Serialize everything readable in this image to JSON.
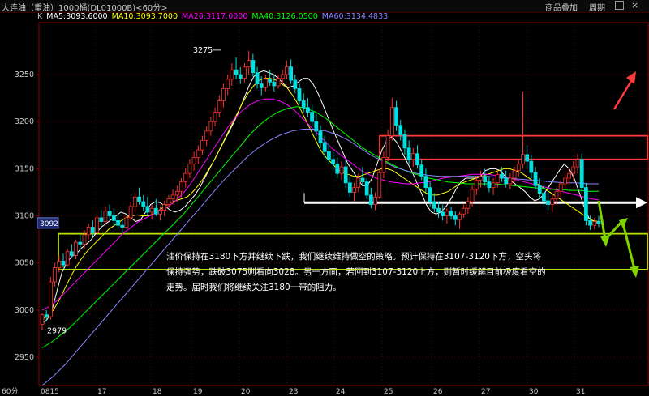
{
  "header": {
    "instrument": "大连油（重油）1000桶(DL01000B)<60分>",
    "menu_add": "商品叠加",
    "menu_period": "周期",
    "k_label": "K"
  },
  "indicators": [
    {
      "label": "MA5:3093.6000",
      "color": "#ffffff"
    },
    {
      "label": "MA10:3093.7000",
      "color": "#ffff00"
    },
    {
      "label": "MA20:3117.0000",
      "color": "#ff00ff"
    },
    {
      "label": "MA40:3126.0500",
      "color": "#00ff00"
    },
    {
      "label": "MA60:3134.4833",
      "color": "#8888ff"
    }
  ],
  "period_label": "60分",
  "current_price_tag": "3092",
  "annotation": {
    "text": "油价保持在3180下方并继续下跌，我们继续维持做空的策略。预计保持在3107-3120下方，空头将保持强势，跌破3075则看向3028。另一方面，若回到3107-3120上方，则暂时缓解目前极度看空的走势。届时我们将继续关注3180一带的阻力。"
  },
  "chart_data": {
    "type": "candlestick",
    "title": "",
    "xlabel": "",
    "ylabel": "",
    "ylim": [
      2920,
      3305
    ],
    "y_ticks": [
      2950,
      3000,
      3050,
      3100,
      3150,
      3200,
      3250
    ],
    "x_tick_labels": [
      "0815",
      "17",
      "18",
      "19",
      "20",
      "23",
      "24",
      "25",
      "26",
      "27",
      "30",
      "31"
    ],
    "high_label": "3275",
    "low_label": "2979",
    "zones": [
      {
        "name": "resistance",
        "low": 3160,
        "high": 3185,
        "color": "#ff3b3b"
      },
      {
        "name": "support",
        "low": 3043,
        "high": 3081,
        "color": "#b8e000"
      }
    ],
    "level_line": 3114,
    "candles": [
      [
        2985,
        2997,
        2979,
        2995
      ],
      [
        2995,
        3000,
        2988,
        2993
      ],
      [
        2993,
        3035,
        2990,
        3030
      ],
      [
        3030,
        3050,
        3025,
        3045
      ],
      [
        3045,
        3058,
        3040,
        3052
      ],
      [
        3052,
        3060,
        3045,
        3048
      ],
      [
        3048,
        3065,
        3046,
        3062
      ],
      [
        3062,
        3070,
        3055,
        3058
      ],
      [
        3058,
        3075,
        3054,
        3072
      ],
      [
        3072,
        3080,
        3066,
        3070
      ],
      [
        3070,
        3085,
        3065,
        3080
      ],
      [
        3080,
        3092,
        3075,
        3088
      ],
      [
        3088,
        3095,
        3078,
        3082
      ],
      [
        3082,
        3100,
        3080,
        3098
      ],
      [
        3098,
        3106,
        3090,
        3094
      ],
      [
        3094,
        3110,
        3090,
        3105
      ],
      [
        3105,
        3112,
        3096,
        3100
      ],
      [
        3100,
        3108,
        3090,
        3095
      ],
      [
        3095,
        3100,
        3085,
        3090
      ],
      [
        3090,
        3096,
        3082,
        3088
      ],
      [
        3088,
        3100,
        3086,
        3098
      ],
      [
        3098,
        3115,
        3095,
        3110
      ],
      [
        3110,
        3125,
        3104,
        3120
      ],
      [
        3120,
        3130,
        3112,
        3115
      ],
      [
        3115,
        3122,
        3105,
        3110
      ],
      [
        3110,
        3120,
        3100,
        3104
      ],
      [
        3104,
        3112,
        3096,
        3108
      ],
      [
        3108,
        3118,
        3100,
        3102
      ],
      [
        3102,
        3110,
        3095,
        3106
      ],
      [
        3106,
        3116,
        3100,
        3112
      ],
      [
        3112,
        3122,
        3108,
        3118
      ],
      [
        3118,
        3128,
        3112,
        3122
      ],
      [
        3122,
        3132,
        3115,
        3126
      ],
      [
        3126,
        3140,
        3120,
        3136
      ],
      [
        3136,
        3150,
        3130,
        3145
      ],
      [
        3145,
        3160,
        3140,
        3155
      ],
      [
        3155,
        3168,
        3148,
        3162
      ],
      [
        3162,
        3175,
        3155,
        3170
      ],
      [
        3170,
        3185,
        3165,
        3180
      ],
      [
        3180,
        3195,
        3174,
        3190
      ],
      [
        3190,
        3205,
        3185,
        3200
      ],
      [
        3200,
        3215,
        3195,
        3210
      ],
      [
        3210,
        3228,
        3205,
        3222
      ],
      [
        3222,
        3240,
        3215,
        3235
      ],
      [
        3235,
        3250,
        3228,
        3245
      ],
      [
        3245,
        3262,
        3238,
        3255
      ],
      [
        3255,
        3268,
        3245,
        3250
      ],
      [
        3250,
        3258,
        3240,
        3246
      ],
      [
        3246,
        3262,
        3242,
        3258
      ],
      [
        3258,
        3275,
        3250,
        3265
      ],
      [
        3265,
        3272,
        3248,
        3252
      ],
      [
        3252,
        3258,
        3235,
        3240
      ],
      [
        3240,
        3248,
        3228,
        3236
      ],
      [
        3236,
        3250,
        3232,
        3245
      ],
      [
        3245,
        3255,
        3238,
        3242
      ],
      [
        3242,
        3250,
        3232,
        3238
      ],
      [
        3238,
        3250,
        3235,
        3246
      ],
      [
        3246,
        3255,
        3240,
        3250
      ],
      [
        3250,
        3265,
        3245,
        3258
      ],
      [
        3258,
        3266,
        3240,
        3244
      ],
      [
        3244,
        3250,
        3230,
        3235
      ],
      [
        3235,
        3240,
        3218,
        3222
      ],
      [
        3222,
        3230,
        3210,
        3215
      ],
      [
        3215,
        3225,
        3205,
        3210
      ],
      [
        3210,
        3218,
        3195,
        3200
      ],
      [
        3200,
        3208,
        3185,
        3190
      ],
      [
        3190,
        3196,
        3172,
        3178
      ],
      [
        3178,
        3185,
        3162,
        3168
      ],
      [
        3168,
        3176,
        3155,
        3160
      ],
      [
        3160,
        3168,
        3148,
        3155
      ],
      [
        3155,
        3162,
        3140,
        3145
      ],
      [
        3145,
        3158,
        3138,
        3152
      ],
      [
        3152,
        3160,
        3130,
        3135
      ],
      [
        3135,
        3142,
        3120,
        3125
      ],
      [
        3125,
        3135,
        3115,
        3130
      ],
      [
        3130,
        3145,
        3125,
        3140
      ],
      [
        3140,
        3152,
        3132,
        3136
      ],
      [
        3136,
        3140,
        3118,
        3122
      ],
      [
        3122,
        3130,
        3108,
        3112
      ],
      [
        3112,
        3125,
        3106,
        3120
      ],
      [
        3120,
        3150,
        3118,
        3146
      ],
      [
        3146,
        3168,
        3140,
        3162
      ],
      [
        3162,
        3192,
        3158,
        3185
      ],
      [
        3185,
        3225,
        3180,
        3215
      ],
      [
        3215,
        3222,
        3190,
        3196
      ],
      [
        3196,
        3202,
        3180,
        3186
      ],
      [
        3186,
        3192,
        3165,
        3172
      ],
      [
        3172,
        3180,
        3155,
        3160
      ],
      [
        3160,
        3172,
        3152,
        3166
      ],
      [
        3166,
        3175,
        3150,
        3154
      ],
      [
        3154,
        3160,
        3138,
        3142
      ],
      [
        3142,
        3150,
        3125,
        3130
      ],
      [
        3130,
        3136,
        3110,
        3115
      ],
      [
        3115,
        3124,
        3104,
        3108
      ],
      [
        3108,
        3115,
        3098,
        3104
      ],
      [
        3104,
        3112,
        3095,
        3100
      ],
      [
        3100,
        3108,
        3092,
        3105
      ],
      [
        3105,
        3110,
        3096,
        3100
      ],
      [
        3100,
        3105,
        3090,
        3096
      ],
      [
        3096,
        3104,
        3086,
        3102
      ],
      [
        3102,
        3112,
        3098,
        3108
      ],
      [
        3108,
        3120,
        3102,
        3115
      ],
      [
        3115,
        3132,
        3110,
        3128
      ],
      [
        3128,
        3142,
        3122,
        3138
      ],
      [
        3138,
        3148,
        3130,
        3142
      ],
      [
        3142,
        3150,
        3132,
        3136
      ],
      [
        3136,
        3142,
        3125,
        3130
      ],
      [
        3130,
        3140,
        3122,
        3135
      ],
      [
        3135,
        3148,
        3130,
        3144
      ],
      [
        3144,
        3152,
        3136,
        3140
      ],
      [
        3140,
        3148,
        3130,
        3134
      ],
      [
        3134,
        3145,
        3128,
        3140
      ],
      [
        3140,
        3152,
        3135,
        3148
      ],
      [
        3148,
        3160,
        3142,
        3155
      ],
      [
        3155,
        3232,
        3150,
        3165
      ],
      [
        3165,
        3175,
        3150,
        3158
      ],
      [
        3158,
        3165,
        3140,
        3146
      ],
      [
        3146,
        3152,
        3128,
        3132
      ],
      [
        3132,
        3140,
        3118,
        3124
      ],
      [
        3124,
        3132,
        3110,
        3116
      ],
      [
        3116,
        3124,
        3106,
        3112
      ],
      [
        3112,
        3122,
        3104,
        3118
      ],
      [
        3118,
        3130,
        3112,
        3126
      ],
      [
        3126,
        3138,
        3120,
        3134
      ],
      [
        3134,
        3145,
        3128,
        3140
      ],
      [
        3140,
        3150,
        3132,
        3145
      ],
      [
        3145,
        3158,
        3138,
        3152
      ],
      [
        3152,
        3166,
        3145,
        3160
      ],
      [
        3160,
        3166,
        3125,
        3130
      ],
      [
        3130,
        3135,
        3090,
        3095
      ],
      [
        3095,
        3100,
        3085,
        3090
      ],
      [
        3090,
        3098,
        3086,
        3094
      ],
      [
        3094,
        3100,
        3088,
        3092
      ]
    ],
    "moving_averages": [
      {
        "name": "MA5",
        "color": "#ffffff",
        "values": [
          2985,
          2990,
          3000,
          3020,
          3040,
          3050,
          3057,
          3060,
          3066,
          3070,
          3075,
          3082,
          3088,
          3092,
          3096,
          3100,
          3104,
          3102,
          3098,
          3094,
          3096,
          3104,
          3112,
          3115,
          3114,
          3110,
          3106,
          3104,
          3106,
          3110,
          3116,
          3122,
          3130,
          3140,
          3150,
          3160,
          3170,
          3180,
          3190,
          3200,
          3212,
          3225,
          3238,
          3248,
          3252,
          3254,
          3252,
          3250,
          3246,
          3240,
          3236,
          3238,
          3242,
          3246,
          3246,
          3240,
          3230,
          3218,
          3205,
          3192,
          3180,
          3168,
          3156,
          3148,
          3140,
          3132,
          3132,
          3140,
          3155,
          3170,
          3180,
          3184,
          3178,
          3168,
          3158,
          3148,
          3136,
          3124,
          3112,
          3104,
          3102,
          3104,
          3110,
          3118,
          3128,
          3136,
          3140,
          3140,
          3140,
          3142,
          3148,
          3150,
          3150,
          3148,
          3142,
          3138,
          3134,
          3130,
          3126,
          3120,
          3116,
          3118,
          3124,
          3132,
          3140,
          3148,
          3155,
          3150,
          3140,
          3126,
          3110,
          3098,
          3094,
          3092
        ]
      },
      {
        "name": "MA10",
        "color": "#ffff00",
        "values": [
          2990,
          2994,
          3000,
          3010,
          3022,
          3034,
          3045,
          3054,
          3062,
          3068,
          3074,
          3080,
          3086,
          3090,
          3094,
          3098,
          3100,
          3101,
          3100,
          3100,
          3102,
          3106,
          3110,
          3114,
          3116,
          3118,
          3120,
          3125,
          3132,
          3140,
          3150,
          3160,
          3172,
          3184,
          3196,
          3208,
          3220,
          3230,
          3238,
          3244,
          3246,
          3246,
          3244,
          3240,
          3236,
          3228,
          3218,
          3206,
          3194,
          3182,
          3170,
          3162,
          3156,
          3150,
          3146,
          3144,
          3142,
          3142,
          3144,
          3146,
          3148,
          3150,
          3150,
          3148,
          3144,
          3140,
          3136,
          3132,
          3128,
          3124,
          3122,
          3122,
          3124,
          3126,
          3130,
          3134,
          3136,
          3138,
          3140,
          3142,
          3144,
          3146,
          3148,
          3150,
          3150,
          3148,
          3146,
          3142,
          3138,
          3134,
          3130,
          3126,
          3122,
          3118,
          3114,
          3110,
          3106,
          3102,
          3098,
          3095,
          3094
        ]
      },
      {
        "name": "MA20",
        "color": "#ff00ff",
        "values": [
          3000,
          3004,
          3010,
          3018,
          3026,
          3034,
          3042,
          3050,
          3058,
          3066,
          3074,
          3082,
          3088,
          3094,
          3098,
          3102,
          3106,
          3110,
          3116,
          3124,
          3134,
          3146,
          3158,
          3170,
          3182,
          3194,
          3204,
          3212,
          3218,
          3222,
          3224,
          3224,
          3222,
          3218,
          3212,
          3204,
          3196,
          3188,
          3180,
          3172,
          3166,
          3160,
          3154,
          3148,
          3144,
          3140,
          3138,
          3136,
          3135,
          3134,
          3134,
          3135,
          3136,
          3138,
          3140,
          3141,
          3142,
          3143,
          3144,
          3144,
          3144,
          3143,
          3142,
          3140,
          3138,
          3136,
          3134,
          3132,
          3130,
          3128,
          3126,
          3124,
          3122,
          3120,
          3118,
          3117
        ]
      },
      {
        "name": "MA40",
        "color": "#00ff00",
        "values": [
          2960,
          2966,
          2974,
          2982,
          2992,
          3002,
          3012,
          3022,
          3032,
          3042,
          3052,
          3062,
          3072,
          3082,
          3092,
          3102,
          3114,
          3126,
          3138,
          3150,
          3162,
          3174,
          3186,
          3196,
          3204,
          3210,
          3214,
          3216,
          3214,
          3210,
          3204,
          3196,
          3188,
          3180,
          3172,
          3166,
          3160,
          3155,
          3150,
          3146,
          3143,
          3140,
          3138,
          3136,
          3135,
          3134,
          3134,
          3134,
          3134,
          3133,
          3132,
          3131,
          3130,
          3129,
          3128,
          3128,
          3127,
          3127,
          3126,
          3126
        ]
      },
      {
        "name": "MA60",
        "color": "#8888ff",
        "values": [
          2920,
          2930,
          2942,
          2956,
          2970,
          2984,
          2998,
          3012,
          3026,
          3040,
          3054,
          3068,
          3082,
          3096,
          3110,
          3124,
          3138,
          3150,
          3162,
          3172,
          3180,
          3186,
          3190,
          3192,
          3192,
          3190,
          3186,
          3180,
          3172,
          3164,
          3158,
          3152,
          3148,
          3145,
          3143,
          3142,
          3142,
          3142,
          3142,
          3142,
          3141,
          3140,
          3139,
          3138,
          3137,
          3136,
          3135,
          3135,
          3134,
          3134
        ]
      }
    ]
  }
}
